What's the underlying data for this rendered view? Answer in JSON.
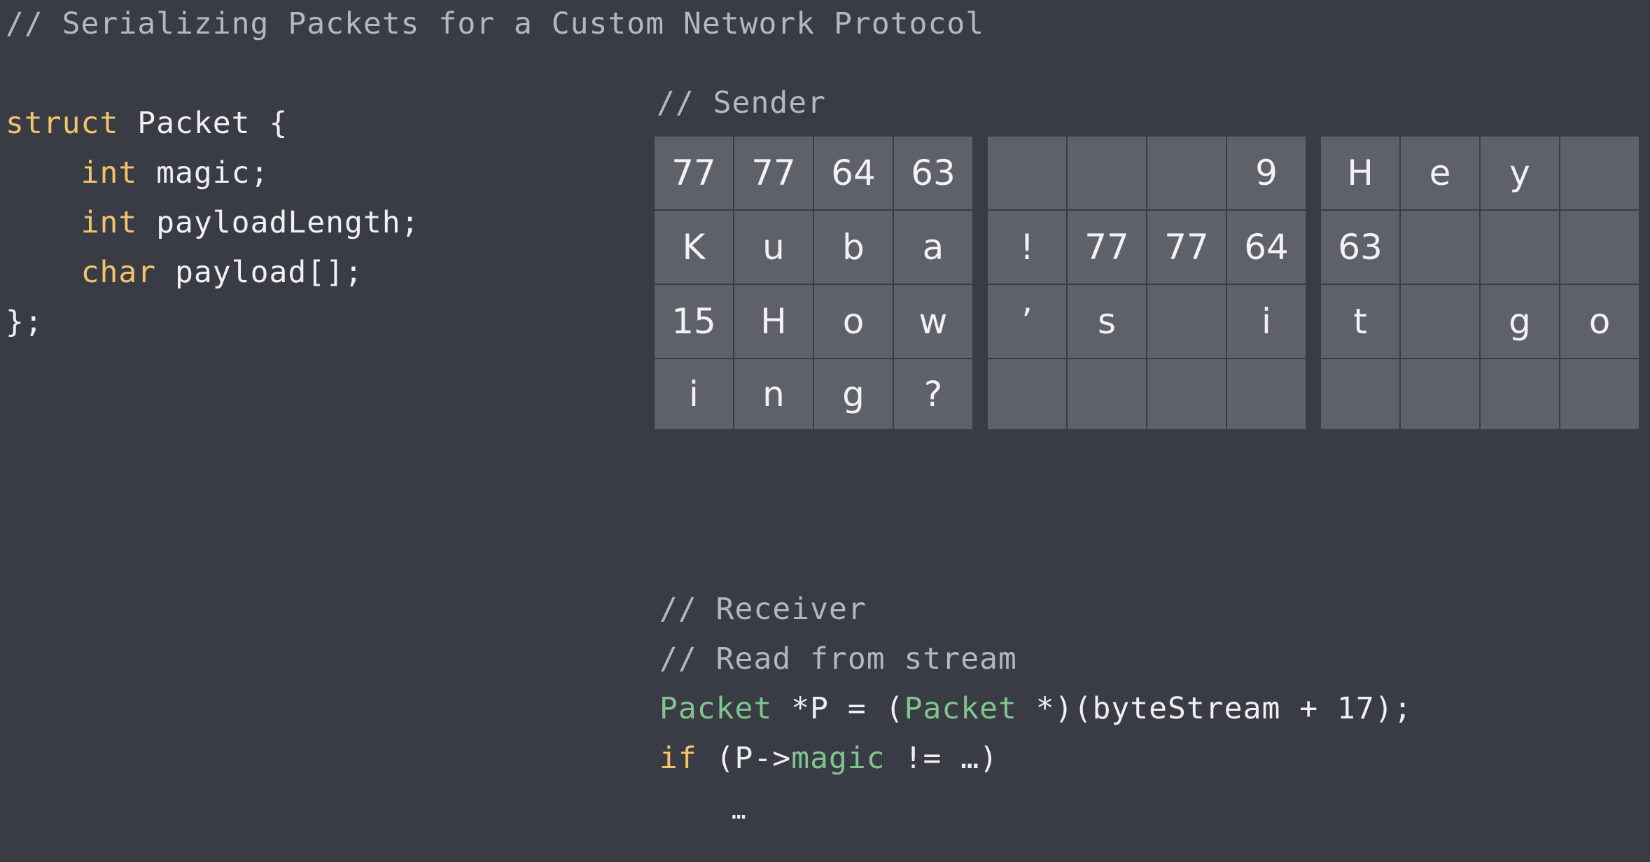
{
  "title_comment": "// Serializing Packets for a Custom Network Protocol",
  "struct_code": {
    "line1_kw": "struct",
    "line1_rest": " Packet {",
    "line2_indent": "    ",
    "line2_kw": "int",
    "line2_rest": " magic;",
    "line3_indent": "    ",
    "line3_kw": "int",
    "line3_rest": " payloadLength;",
    "line4_indent": "    ",
    "line4_kw": "char",
    "line4_rest": " payload[];",
    "line5": "};"
  },
  "sender": {
    "comment": "// Sender",
    "blocks": [
      [
        "77",
        "77",
        "64",
        "63",
        "K",
        "u",
        "b",
        "a",
        "15",
        "H",
        "o",
        "w",
        "i",
        "n",
        "g",
        "?"
      ],
      [
        "",
        "",
        "",
        "9",
        "!",
        "77",
        "77",
        "64",
        "’",
        "s",
        "",
        "i",
        "",
        "",
        "",
        ""
      ],
      [
        "H",
        "e",
        "y",
        "",
        "63",
        "",
        "",
        "",
        "t",
        "",
        "g",
        "o",
        "",
        "",
        "",
        ""
      ]
    ]
  },
  "receiver": {
    "comment1": "// Receiver",
    "comment2": "// Read from stream",
    "line3_type1": "Packet",
    "line3_mid": " *P = (",
    "line3_type2": "Packet",
    "line3_end": " *)(byteStream + 17);",
    "line4_kw": "if",
    "line4_mid": " (P->",
    "line4_field": "magic",
    "line4_end": " != …)",
    "line5": "…"
  }
}
